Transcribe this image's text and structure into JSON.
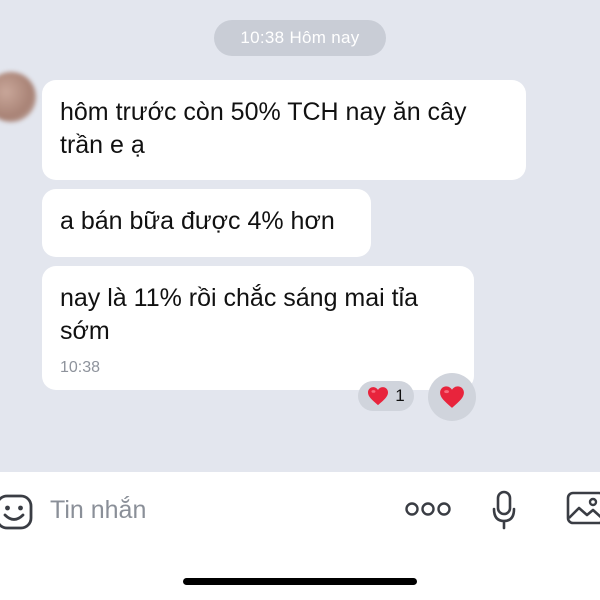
{
  "chat": {
    "time_chip": "10:38 Hôm nay",
    "messages": [
      {
        "text": "hôm trước còn 50% TCH nay ăn cây trần e ạ"
      },
      {
        "text": "a bán bữa được 4% hơn"
      },
      {
        "text": "nay là 11% rồi chắc sáng mai tỉa sớm",
        "time": "10:38"
      }
    ],
    "reaction": {
      "icon": "heart-icon",
      "count": "1"
    },
    "reaction_button_icon": "heart-icon"
  },
  "input_bar": {
    "placeholder": "Tin nhắn",
    "icons": [
      "smile-icon",
      "more-icon",
      "microphone-icon",
      "image-icon"
    ]
  },
  "colors": {
    "chat_background": "#e3e6ee",
    "heart": "#e8243c",
    "time_chip": "#c9cdd6"
  }
}
